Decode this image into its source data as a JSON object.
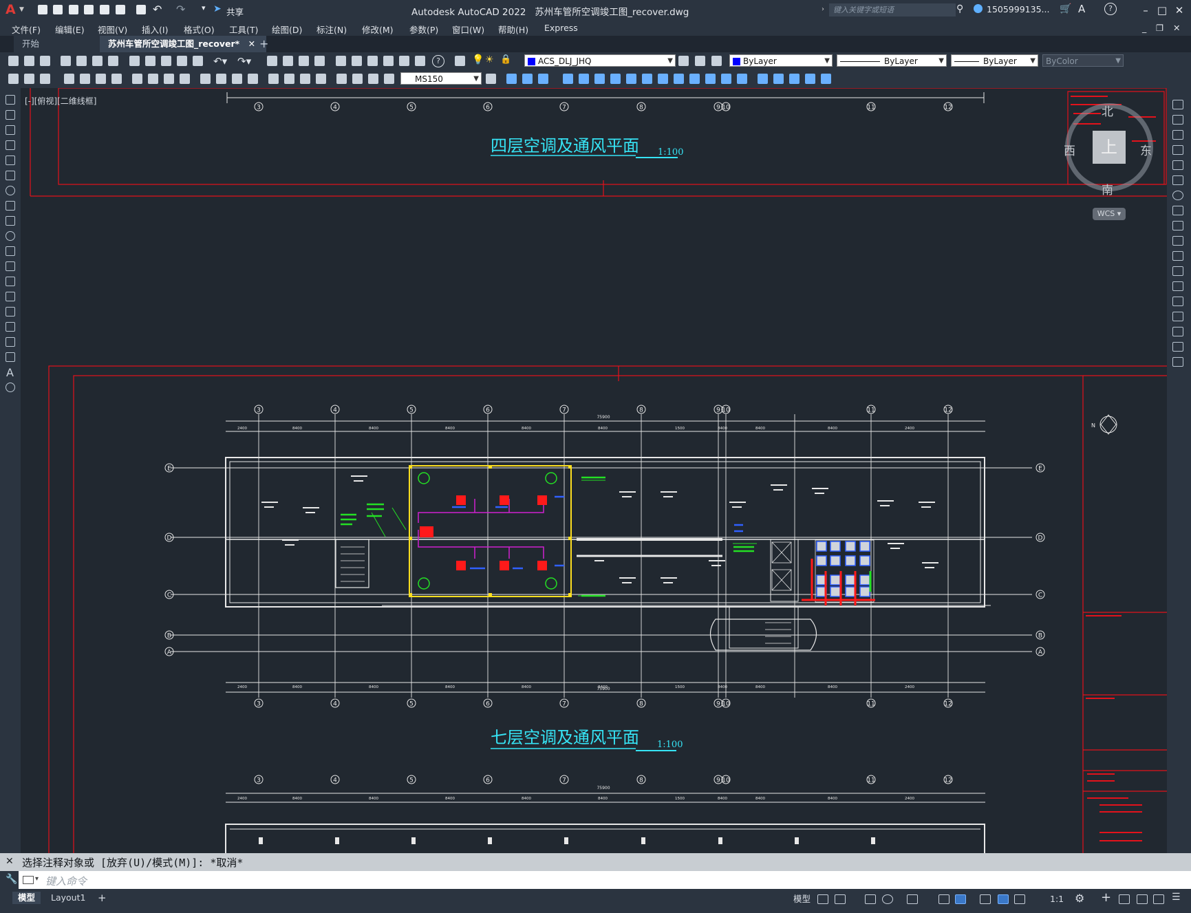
{
  "window": {
    "app_title": "Autodesk AutoCAD 2022",
    "doc_title": "苏州车管所空调竣工图_recover.dwg",
    "share_label": "共享",
    "search_placeholder": "键入关键字或短语",
    "user": "1505999135...",
    "help": "?"
  },
  "menubar": [
    "文件(F)",
    "编辑(E)",
    "视图(V)",
    "插入(I)",
    "格式(O)",
    "工具(T)",
    "绘图(D)",
    "标注(N)",
    "修改(M)",
    "参数(P)",
    "窗口(W)",
    "帮助(H)",
    "Express"
  ],
  "tabs": {
    "start": "开始",
    "document": "苏州车管所空调竣工图_recover*",
    "add": "+"
  },
  "toolbar": {
    "layer": "ACS_DLJ_JHQ",
    "color": "ByLayer",
    "linetype": "ByLayer",
    "lineweight": "ByLayer",
    "plotstyle": "ByColor",
    "dimstyle": "MS150"
  },
  "viewport": {
    "label": "[-][俯视][二维线框]"
  },
  "viewcube": {
    "north": "北",
    "south": "南",
    "east": "东",
    "west": "西",
    "face": "上",
    "wcs": "WCS"
  },
  "drawing": {
    "title_top": "四层空调及通风平面",
    "title_mid": "七层空调及通风平面",
    "scale": "1:100",
    "grid_labels": [
      "3",
      "4",
      "5",
      "6",
      "7",
      "8",
      "9",
      "10",
      "11",
      "12"
    ],
    "row_labels": [
      "E",
      "D",
      "C",
      "B",
      "A"
    ],
    "total_dim": "75900",
    "dims": [
      "2400",
      "8400",
      "8400",
      "8400",
      "8400",
      "8400",
      "1500",
      "8400",
      "8400",
      "8400",
      "2400"
    ],
    "north_mark": "N"
  },
  "command": {
    "history": "选择注释对象或 [放弃(U)/模式(M)]: *取消*",
    "placeholder": "键入命令"
  },
  "statusbar": {
    "model_tab": "模型",
    "layout_tab": "Layout1",
    "add": "+",
    "model_button": "模型",
    "scale": "1:1"
  },
  "colors": {
    "background": "#212830",
    "frame_red": "#e4121b",
    "title_cyan": "#36e4f5",
    "dim_white": "#e8e8e8",
    "equipment_red": "#ff1a1a",
    "pipe_magenta": "#d020d0",
    "note_green": "#24e024",
    "highlight_yellow": "#ffe020"
  }
}
